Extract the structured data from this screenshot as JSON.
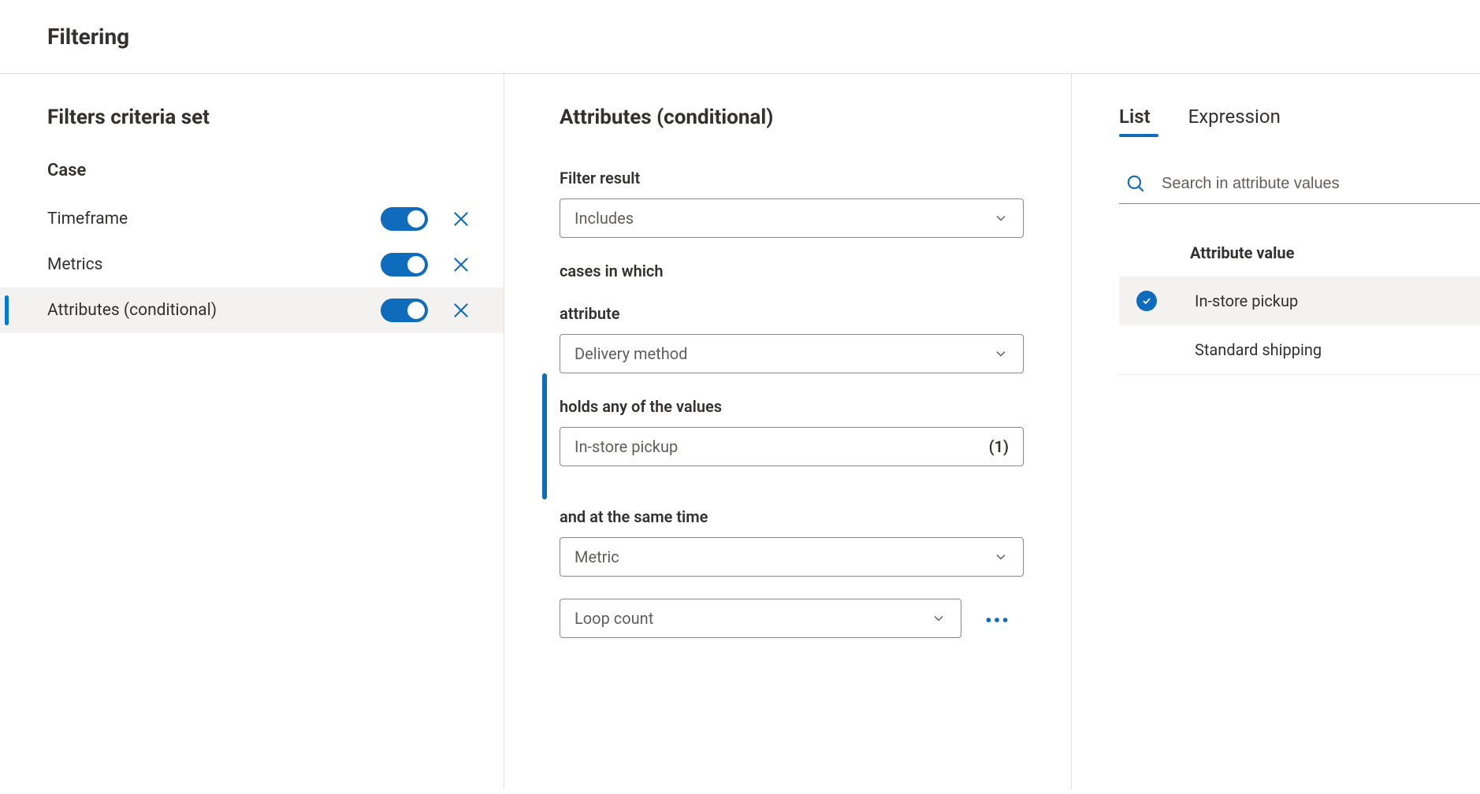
{
  "page_title": "Filtering",
  "left": {
    "heading": "Filters criteria set",
    "group_label": "Case",
    "items": [
      {
        "label": "Timeframe",
        "enabled": true,
        "selected": false
      },
      {
        "label": "Metrics",
        "enabled": true,
        "selected": false
      },
      {
        "label": "Attributes (conditional)",
        "enabled": true,
        "selected": true
      }
    ]
  },
  "mid": {
    "title": "Attributes (conditional)",
    "filter_result_label": "Filter result",
    "filter_result_value": "Includes",
    "cases_label": "cases in which",
    "attribute_label": "attribute",
    "attribute_value": "Delivery method",
    "holds_label": "holds any of the values",
    "holds_value": "In-store pickup",
    "holds_count": "(1)",
    "sametime_label": "and at the same time",
    "sametime_value": "Metric",
    "metric_detail_value": "Loop count"
  },
  "right": {
    "tabs": {
      "list": "List",
      "expression": "Expression",
      "active": "list"
    },
    "search_placeholder": "Search in attribute values",
    "attr_heading": "Attribute value",
    "values": [
      {
        "label": "In-store pickup",
        "selected": true
      },
      {
        "label": "Standard shipping",
        "selected": false
      }
    ]
  }
}
